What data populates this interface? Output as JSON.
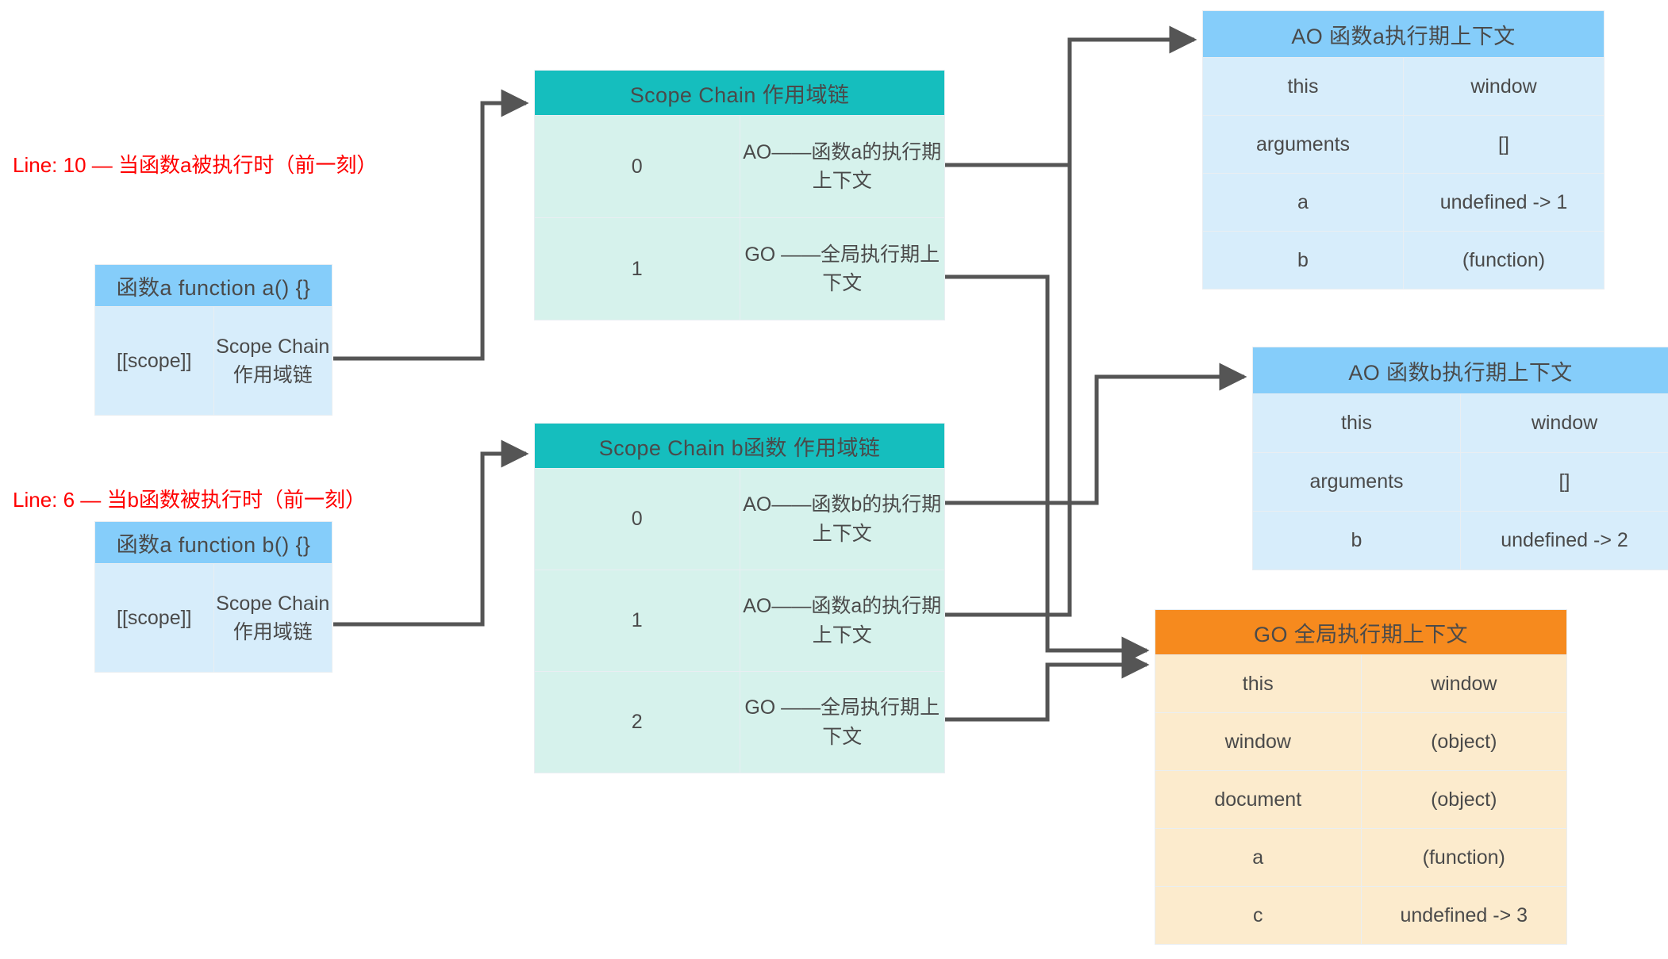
{
  "diagram": {
    "title": "JavaScript Scope Chain / Execution Context Diagram",
    "colors": {
      "teal_header": "#15BEBE",
      "blue_header": "#85CDFA",
      "orange_header": "#F68A1E",
      "mint_cell": "#D6F2EC",
      "lightblue_cell": "#D7EDFB",
      "cream_cell": "#FCEBCD",
      "connector": "#555555",
      "note_text": "#FF0000"
    }
  },
  "notes": [
    {
      "id": "note-a",
      "text": "Line: 10 — 当函数a被执行时（前一刻）"
    },
    {
      "id": "note-b",
      "text": "Line: 6 — 当b函数被执行时（前一刻）"
    }
  ],
  "function_a_table": {
    "header": "函数a function a() {}",
    "rows": [
      {
        "key": "[[scope]]",
        "value": "Scope Chain 作用域链"
      }
    ]
  },
  "function_b_table": {
    "header": "函数a function b() {}",
    "rows": [
      {
        "key": "[[scope]]",
        "value": "Scope Chain 作用域链"
      }
    ]
  },
  "scope_chain_a_table": {
    "header": "Scope Chain  作用域链",
    "rows": [
      {
        "index": "0",
        "value": "AO——函数a的执行期上下文"
      },
      {
        "index": "1",
        "value": "GO ——全局执行期上下文"
      }
    ]
  },
  "scope_chain_b_table": {
    "header": "Scope Chain b函数 作用域链",
    "rows": [
      {
        "index": "0",
        "value": "AO——函数b的执行期上下文"
      },
      {
        "index": "1",
        "value": "AO——函数a的执行期上下文"
      },
      {
        "index": "2",
        "value": "GO ——全局执行期上下文"
      }
    ]
  },
  "ao_a_table": {
    "header": "AO 函数a执行期上下文",
    "rows": [
      {
        "key": "this",
        "value": "window"
      },
      {
        "key": "arguments",
        "value": "[]"
      },
      {
        "key": "a",
        "value": "undefined -> 1"
      },
      {
        "key": "b",
        "value": "(function)"
      }
    ]
  },
  "ao_b_table": {
    "header": "AO 函数b执行期上下文",
    "rows": [
      {
        "key": "this",
        "value": "window"
      },
      {
        "key": "arguments",
        "value": "[]"
      },
      {
        "key": "b",
        "value": "undefined -> 2"
      }
    ]
  },
  "go_table": {
    "header": "GO 全局执行期上下文",
    "rows": [
      {
        "key": "this",
        "value": "window"
      },
      {
        "key": "window",
        "value": "(object)"
      },
      {
        "key": "document",
        "value": "(object)"
      },
      {
        "key": "a",
        "value": "(function)"
      },
      {
        "key": "c",
        "value": "undefined -> 3"
      }
    ]
  }
}
